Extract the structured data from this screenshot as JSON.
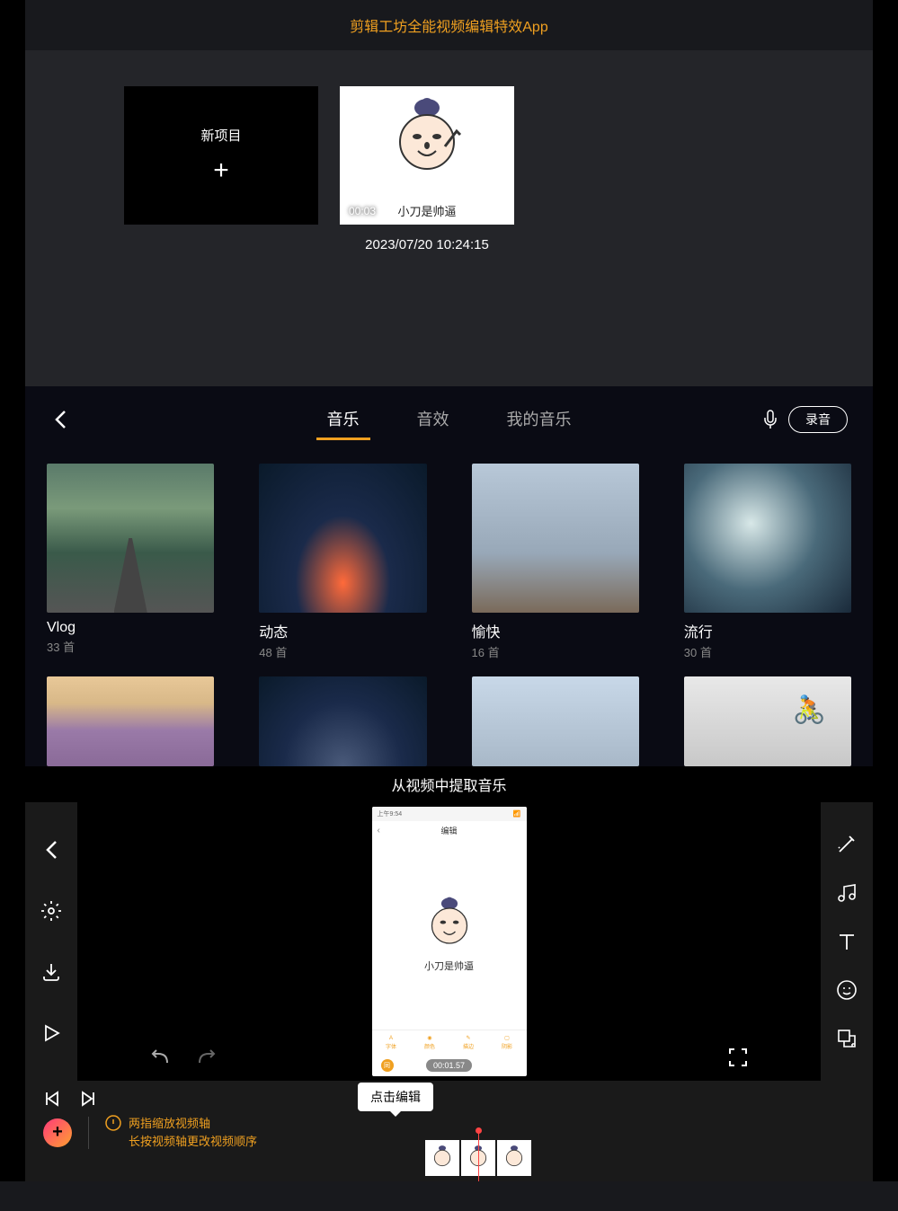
{
  "header": {
    "title": "剪辑工坊全能视频编辑特效App"
  },
  "projects": {
    "new_label": "新项目",
    "items": [
      {
        "duration": "00:03",
        "caption": "小刀是帅逼",
        "date": "2023/07/20 10:24:15"
      }
    ]
  },
  "music": {
    "tabs": [
      "音乐",
      "音效",
      "我的音乐"
    ],
    "active_tab": 0,
    "record_label": "录音",
    "categories_row1": [
      {
        "name": "Vlog",
        "count": "33 首"
      },
      {
        "name": "动态",
        "count": "48 首"
      },
      {
        "name": "愉快",
        "count": "16 首"
      },
      {
        "name": "流行",
        "count": "30 首"
      }
    ],
    "extract_label": "从视频中提取音乐"
  },
  "editor": {
    "phone": {
      "status_left": "上午9:54",
      "header_title": "编辑",
      "body_text": "小刀是帅逼",
      "toolbar": [
        "字体",
        "颜色",
        "描边",
        "阴影"
      ],
      "time": "00:01.57"
    }
  },
  "timeline": {
    "tooltip": "点击编辑",
    "tip_line1": "两指缩放视频轴",
    "tip_line2": "长按视频轴更改视频顺序"
  }
}
